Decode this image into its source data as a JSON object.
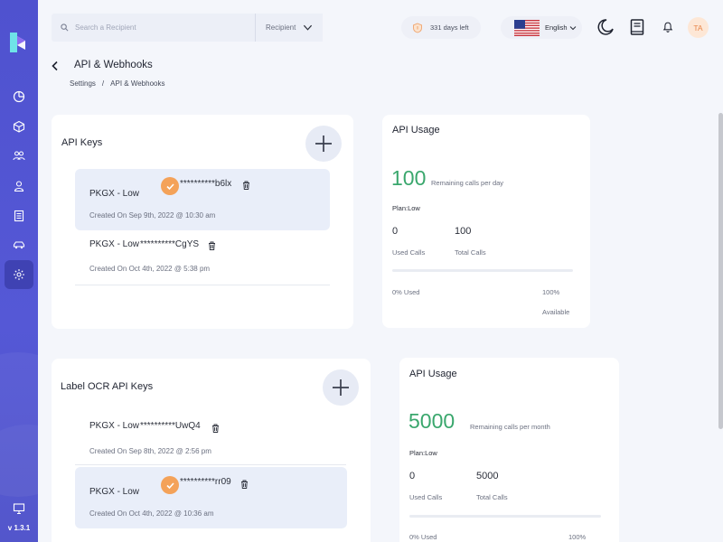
{
  "app": {
    "version": "v 1.3.1"
  },
  "search": {
    "placeholder": "Search a Recipient",
    "filter_label": "Recipient"
  },
  "header": {
    "days_left": "331 days left",
    "language": "English",
    "avatar_initials": "TA"
  },
  "page": {
    "title": "API & Webhooks",
    "breadcrumb": [
      "Settings",
      "/",
      "API & Webhooks"
    ]
  },
  "api_keys": {
    "title": "API Keys",
    "rows": [
      {
        "name": "PKGX - Low",
        "mask": "**********b6lx",
        "created": "Created On Sep 9th, 2022 @ 10:30 am",
        "selected": true
      },
      {
        "name": "PKGX - Low",
        "mask": "**********CgYS",
        "created": "Created On Oct 4th, 2022 @ 5:38 pm",
        "selected": false
      }
    ]
  },
  "usage_1": {
    "title": "API Usage",
    "remaining": "100",
    "remaining_caption": "Remaining calls per day",
    "plan": "Plan:Low",
    "used_calls": "0",
    "used_calls_label": "Used Calls",
    "total_calls": "100",
    "total_calls_label": "Total Calls",
    "used_pct": "0% Used",
    "available_pct": "100%",
    "available_label": "Available",
    "used_fraction": 0
  },
  "label_ocr": {
    "title": "Label OCR API Keys",
    "rows": [
      {
        "name": "PKGX - Low",
        "mask": "**********UwQ4",
        "created": "Created On Sep 8th, 2022 @ 2:56 pm",
        "selected": false
      },
      {
        "name": "PKGX - Low",
        "mask": "**********rr09",
        "created": "Created On Oct 4th, 2022 @ 10:36 am",
        "selected": true
      }
    ]
  },
  "usage_2": {
    "title": "API Usage",
    "remaining": "5000",
    "remaining_caption": "Remaining calls per month",
    "plan": "Plan:Low",
    "used_calls": "0",
    "used_calls_label": "Used Calls",
    "total_calls": "5000",
    "total_calls_label": "Total Calls",
    "used_pct": "0% Used",
    "available_pct": "100%",
    "used_fraction": 0
  },
  "colors": {
    "sidebar": "#5558d6",
    "accent_green": "#3aa76d",
    "check_orange": "#f4a259",
    "avatar_text": "#e8864a"
  },
  "icons": [
    "logo",
    "dashboard-icon",
    "box-icon",
    "users-icon",
    "user-icon",
    "document-icon",
    "car-icon",
    "settings-icon",
    "monitor-icon",
    "search-icon",
    "chevron-down-icon",
    "shield-icon",
    "us-flag-icon",
    "moon-icon",
    "book-icon",
    "bell-icon",
    "back-arrow-icon",
    "plus-icon",
    "trash-icon",
    "check-icon"
  ]
}
